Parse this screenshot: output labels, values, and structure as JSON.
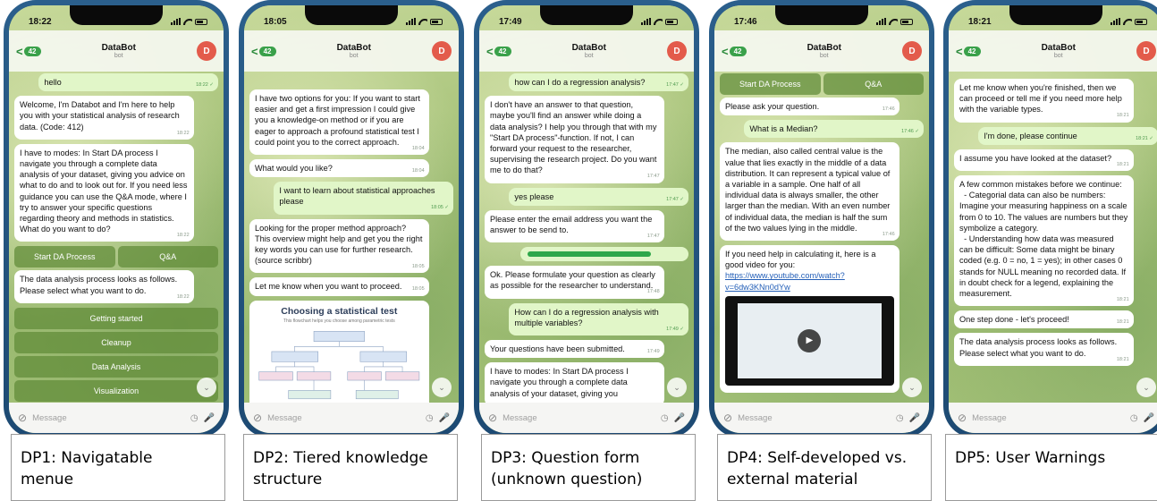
{
  "common": {
    "title": "DataBot",
    "subtitle": "bot",
    "back_count": "42",
    "avatar_initial": "D",
    "back_symbol": "<",
    "input_placeholder": "Message",
    "scroll_down_symbol": "⌄"
  },
  "phones": [
    {
      "time": "18:22",
      "caption": "DP1: Navigatable\nmenue",
      "messages": [
        {
          "out": true,
          "text": "hello",
          "time": "18:22 ✓"
        },
        {
          "out": false,
          "text": "Welcome, I'm Databot and I'm here to help you with your statistical analysis of research data. (Code: 412)",
          "time": "18:22"
        },
        {
          "out": false,
          "text": "I have to modes: In Start DA process I navigate you through a complete data analysis of your dataset, giving you advice on what to do and to look out for. If you need less guidance you can use the Q&A mode, where I try to answer your specific questions regarding theory and methods in statistics. What do you want to do?",
          "time": "18:22"
        }
      ],
      "keyboard_row": [
        "Start DA Process",
        "Q&A"
      ],
      "message_after": {
        "out": false,
        "text": "The data analysis process looks as follows. Please select what you want to do.",
        "time": "18:22"
      },
      "menu": [
        "Getting started",
        "Cleanup",
        "Data Analysis",
        "Visualization"
      ]
    },
    {
      "time": "18:05",
      "caption": "DP2: Tiered knowledge\nstructure",
      "messages": [
        {
          "out": false,
          "text": "I have two options for you: If you want to start easier and get a first impression I could give you a knowledge-on method or if you are eager to approach a profound statistical test I could point you to the correct approach.",
          "time": "18:04"
        },
        {
          "out": false,
          "text": "What would you like?",
          "time": "18:04"
        },
        {
          "out": true,
          "text": "I want to learn about statistical approaches please",
          "time": "18:05 ✓"
        },
        {
          "out": false,
          "text": "Looking for the proper method approach? This overview might help and get you the right key words you can use for further research. (source scribbr)",
          "time": "18:05"
        },
        {
          "out": false,
          "text": "Let me know when you want to proceed.",
          "time": "18:05"
        }
      ],
      "image_card": {
        "title": "Choosing a statistical test",
        "subtitle": "This flowchart helps you choose among parametric tests"
      }
    },
    {
      "time": "17:49",
      "caption": "DP3: Question form\n(unknown question)",
      "messages": [
        {
          "out": true,
          "text": "how can I do a regression analysis?",
          "time": "17:47 ✓"
        },
        {
          "out": false,
          "text": "I don't have an answer to that question, maybe you'll find an answer while doing a data analysis? I help you through that with my \"Start DA process\"-function. If not, I can forward your request to the researcher, supervising the research project. Do you want me to do that?",
          "time": "17:47"
        },
        {
          "out": true,
          "text": "yes please",
          "time": "17:47 ✓"
        },
        {
          "out": false,
          "text": "Please enter the email address you want the answer to be send to.",
          "time": "17:47"
        },
        {
          "progress": 0.8
        },
        {
          "out": false,
          "text": "Ok. Please formulate your question as clearly as possible for the researcher to understand.",
          "time": "17:48"
        },
        {
          "out": true,
          "text": "How can I do a regression analysis with multiple variables?",
          "time": "17:49 ✓"
        },
        {
          "out": false,
          "text": "Your questions have been submitted.",
          "time": "17:49"
        },
        {
          "out": false,
          "text": "I have to modes: In Start DA process I navigate you through a complete data analysis of your dataset, giving you",
          "time": ""
        }
      ]
    },
    {
      "time": "17:46",
      "caption": "DP4: Self-developed vs.\nexternal material",
      "keyboard_row": [
        "Start DA Process",
        "Q&A"
      ],
      "messages": [
        {
          "out": false,
          "text": "Please ask your question.",
          "time": "17:46"
        },
        {
          "out": true,
          "text": "What is a Median?",
          "time": "17:46 ✓"
        },
        {
          "out": false,
          "text": "The median, also called central value is the value that lies exactly in the middle of a data distribution. It can represent a typical value of a variable in a sample. One half of all individual data is always smaller, the other larger than the median. With an even number of individual data, the median is half the sum of the two values lying in the middle.",
          "time": "17:46"
        }
      ],
      "video_msg": {
        "text": "If you need help in calculating it, here is a good video for you: ",
        "link": "https://www.youtube.com/watch?v=6dw3KNn0dYw"
      }
    },
    {
      "time": "18:21",
      "caption": "DP5: User Warnings",
      "messages": [
        {
          "out": false,
          "text": "Let me know when you're finished, then we can proceed or tell me if you need more help with the variable types.",
          "time": "18:21"
        },
        {
          "out": true,
          "text": "I'm done, please continue",
          "time": "18:21 ✓"
        },
        {
          "out": false,
          "text": "I assume you have looked at the dataset?",
          "time": "18:21"
        },
        {
          "out": false,
          "text": "A few common mistakes before we continue:\n  - Categorial data can also be numbers: Imagine your measuring happiness on a scale from 0 to 10. The values are numbers but they symbolize a category.\n  - Understanding how data was measured can be difficult: Some data might be binary coded (e.g. 0 = no, 1 = yes); in other cases 0 stands for NULL meaning no recorded data. If in doubt check for a legend, explaining the measurement.",
          "time": "18:21"
        },
        {
          "out": false,
          "text": "One step done - let's proceed!",
          "time": "18:21"
        },
        {
          "out": false,
          "text": "The data analysis process looks as follows. Please select what you want to do.",
          "time": "18:21"
        }
      ]
    }
  ]
}
